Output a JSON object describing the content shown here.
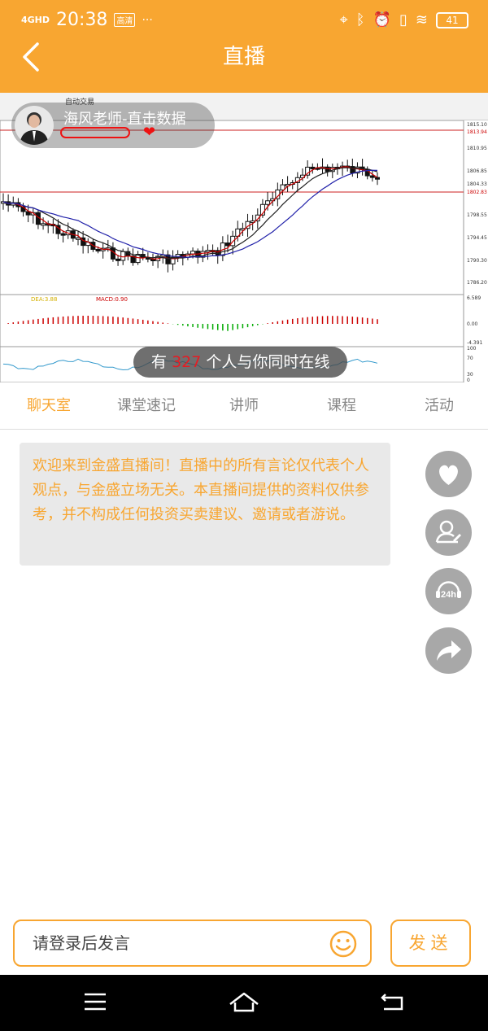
{
  "status_bar": {
    "network": "4GHD",
    "time": "20:38",
    "badge": "高清",
    "more": "···",
    "battery": "41"
  },
  "header": {
    "title": "直播",
    "back_icon": "chevron-left-icon"
  },
  "live": {
    "host_name": "海风老师-直击数据",
    "online_prefix": "有",
    "online_count": "327",
    "online_suffix": "个人与你同时在线",
    "toolbar_label": "自动交易",
    "price_labels": [
      "1815.10",
      "1813.94",
      "1810.95",
      "1806.85",
      "1804.33",
      "1802.83",
      "1798.55",
      "1794.45",
      "1790.30",
      "1786.20"
    ],
    "macd_label": "MACD:0.90",
    "macd_left_label": "DEA:3.88",
    "macd_scale": [
      "6.589",
      "0.00",
      "-4.391"
    ],
    "osc_scale": [
      "100",
      "70",
      "30",
      "0"
    ]
  },
  "tabs": [
    {
      "label": "聊天室",
      "active": true
    },
    {
      "label": "课堂速记",
      "active": false
    },
    {
      "label": "讲师",
      "active": false
    },
    {
      "label": "课程",
      "active": false
    },
    {
      "label": "活动",
      "active": false
    }
  ],
  "notice": {
    "text": "欢迎来到金盛直播间！直播中的所有言论仅代表个人观点，与金盛立场无关。本直播间提供的资料仅供参考，并不构成任何投资买卖建议、邀请或者游说。"
  },
  "side_actions": [
    {
      "icon": "heart-icon"
    },
    {
      "icon": "teacher-edit-icon"
    },
    {
      "icon": "service-24h-icon"
    },
    {
      "icon": "share-icon"
    }
  ],
  "input": {
    "placeholder": "请登录后发言",
    "send_label": "发送",
    "emoji_icon": "smiley-icon"
  },
  "colors": {
    "accent": "#f8a631",
    "red": "#e51c23"
  }
}
